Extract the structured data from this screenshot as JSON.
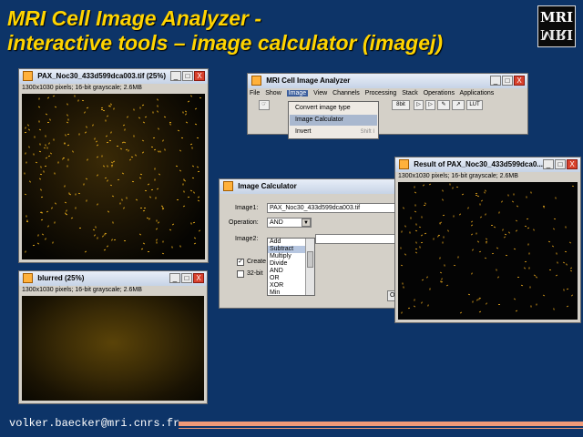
{
  "slide": {
    "title_line1": "MRI Cell Image Analyzer -",
    "title_line2": "interactive tools – image calculator (imagej)",
    "logo_text": "MRI",
    "email": "volker.baecker@mri.cnrs.fr",
    "colors": {
      "background": "#0d3468",
      "title": "#ffd400",
      "accent_bar": "#f09a78"
    }
  },
  "image_window_1": {
    "title": "PAX_Noc30_433d599dca003.tif (25%)",
    "info": "1300x1030 pixels; 16-bit grayscale; 2.6MB"
  },
  "image_window_2": {
    "title": "blurred (25%)",
    "info": "1300x1030 pixels; 16-bit grayscale; 2.6MB"
  },
  "analyzer": {
    "title": "MRI Cell Image Analyzer",
    "menus": [
      "File",
      "Show",
      "Image",
      "View",
      "Channels",
      "Processing",
      "Stack",
      "Operations",
      "Applications"
    ],
    "selected_menu": "Image",
    "tools": [
      "8bit",
      "LUT"
    ],
    "dropdown": [
      {
        "label": "Convert image type",
        "shortcut": ""
      },
      {
        "label": "Image Calculator",
        "shortcut": ""
      },
      {
        "label": "Invert",
        "shortcut": "Shift I"
      }
    ]
  },
  "calculator": {
    "title": "Image Calculator",
    "image1_label": "Image1:",
    "image1_value": "PAX_Noc30_433d599dca003.tif",
    "operation_label": "Operation:",
    "operation_value": "AND",
    "image2_label": "Image2:",
    "create_label": "Create",
    "create_checked": true,
    "bit32_label": "32-bit",
    "bit32_checked": false,
    "ok_label": "O",
    "operations": [
      "Add",
      "Subtract",
      "Multiply",
      "Divide",
      "AND",
      "OR",
      "XOR",
      "Min"
    ],
    "highlighted_operation": "Subtract"
  },
  "result_window": {
    "title": "Result of PAX_Noc30_433d599dca0...",
    "info": "1300x1030 pixels; 16-bit grayscale; 2.6MB"
  },
  "window_buttons": {
    "minimize": "_",
    "maximize": "□",
    "close": "X"
  }
}
